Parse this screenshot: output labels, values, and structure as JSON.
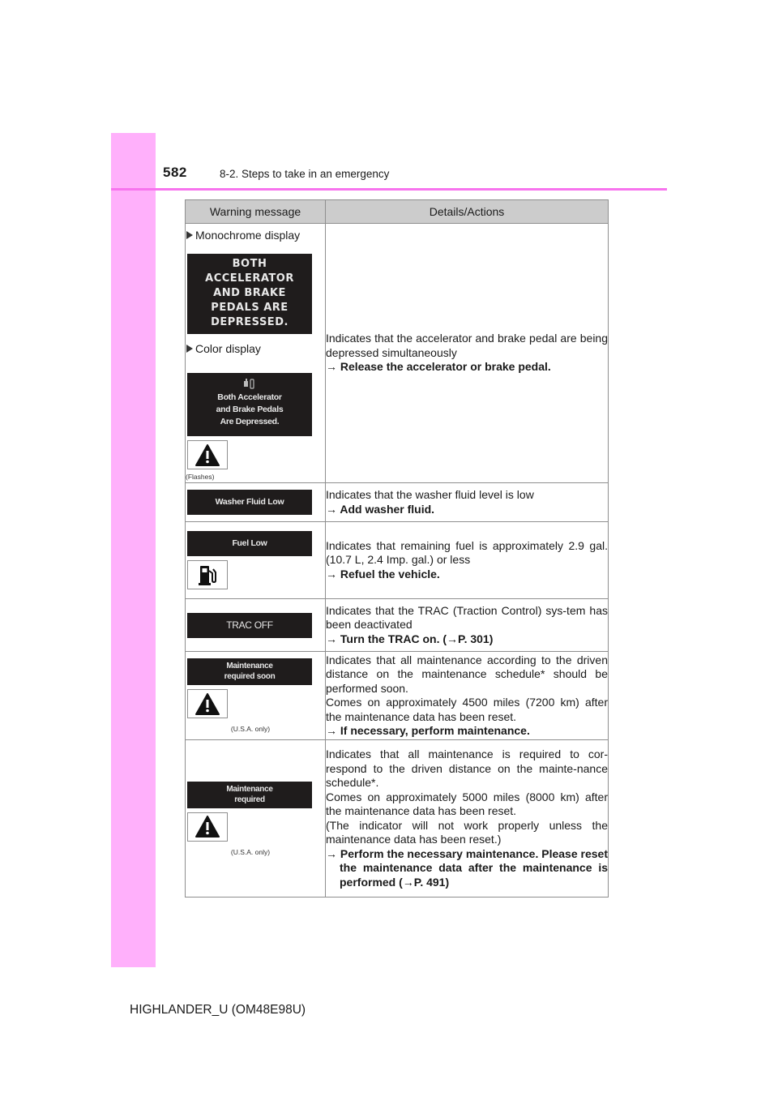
{
  "header": {
    "page_number": "582",
    "section_title": "8-2. Steps to take in an emergency"
  },
  "footer": {
    "document_code": "HIGHLANDER_U (OM48E98U)"
  },
  "colors": {
    "margin_strip": "#ffb0fb",
    "header_rule": "#f774ee",
    "table_header_bg": "#cccccc",
    "screen_bg": "#1f1c1c"
  },
  "table": {
    "headers": [
      "Warning message",
      "Details/Actions"
    ],
    "rows": [
      {
        "mono_label": "Monochrome display",
        "mono_screen_lines": [
          "BOTH",
          "ACCELERATOR",
          "AND BRAKE",
          "PEDALS ARE",
          "DEPRESSED."
        ],
        "color_label": "Color display",
        "color_screen_lines": [
          "Both Accelerator",
          "and Brake Pedals",
          "Are Depressed."
        ],
        "icon": "warning-triangle-icon",
        "icon_note": "(Flashes)",
        "detail": "Indicates that the accelerator and brake pedal are being depressed simultaneously",
        "arrow": "→",
        "action": "Release the accelerator or brake pedal."
      },
      {
        "screen_text": "Washer Fluid Low",
        "detail": "Indicates that the washer fluid level is low",
        "arrow": "→",
        "action": "Add washer fluid."
      },
      {
        "screen_text": "Fuel Low",
        "icon": "fuel-pump-icon",
        "detail": "Indicates that remaining fuel is approximately 2.9 gal. (10.7 L, 2.4 Imp. gal.) or less",
        "arrow": "→",
        "action": "Refuel the vehicle."
      },
      {
        "screen_text": "TRAC OFF",
        "detail": "Indicates that the TRAC (Traction Control) sys-tem has been deactivated",
        "arrow": "→",
        "action": "Turn the TRAC on. (→P. 301)"
      },
      {
        "screen_lines": [
          "Maintenance",
          "required soon"
        ],
        "icon": "warning-triangle-icon",
        "icon_note": "(U.S.A. only)",
        "detail": "Indicates that all maintenance according to the driven distance on the maintenance schedule* should be performed soon.",
        "detail2": "Comes on approximately 4500 miles (7200 km) after the maintenance data has been reset.",
        "arrow": "→",
        "action": "If necessary, perform maintenance."
      },
      {
        "screen_lines": [
          "Maintenance",
          "required"
        ],
        "icon": "warning-triangle-icon",
        "icon_note": "(U.S.A. only)",
        "detail": "Indicates that all maintenance is required to cor-respond to the driven distance on the mainte-nance schedule*.",
        "detail2": "Comes on approximately 5000  miles (8000 km) after the maintenance data has been reset.",
        "detail3": "(The indicator will not work properly unless the maintenance data has been reset.)",
        "arrow": "→",
        "action": "Perform the necessary maintenance. Please reset the maintenance data after the maintenance is performed (→P. 491)"
      }
    ]
  }
}
